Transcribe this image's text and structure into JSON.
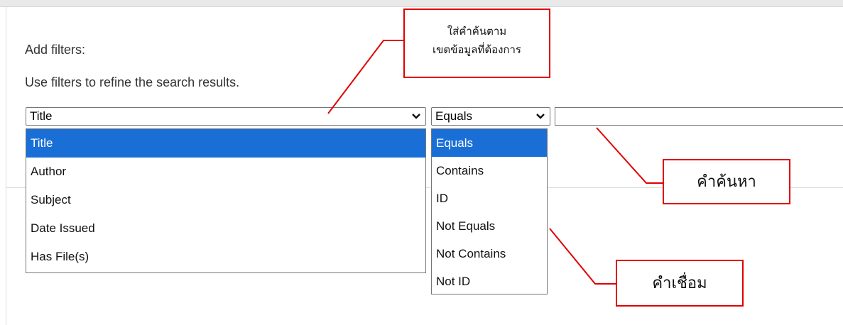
{
  "filters": {
    "heading": "Add filters:",
    "help": "Use filters to refine the search results.",
    "field_select": {
      "value": "Title",
      "options": [
        {
          "label": "Title",
          "selected": true
        },
        {
          "label": "Author",
          "selected": false
        },
        {
          "label": "Subject",
          "selected": false
        },
        {
          "label": "Date Issued",
          "selected": false
        },
        {
          "label": "Has File(s)",
          "selected": false
        }
      ]
    },
    "operator_select": {
      "value": "Equals",
      "options": [
        {
          "label": "Equals",
          "selected": true
        },
        {
          "label": "Contains",
          "selected": false
        },
        {
          "label": "ID",
          "selected": false
        },
        {
          "label": "Not Equals",
          "selected": false
        },
        {
          "label": "Not Contains",
          "selected": false
        },
        {
          "label": "Not ID",
          "selected": false
        }
      ]
    },
    "query_input": {
      "value": ""
    }
  },
  "annotations": {
    "field_note_line1": "ใส่คำค้นตาม",
    "field_note_line2": "เขตข้อมูลที่ต้องการ",
    "query_note": "คำค้นหา",
    "operator_note": "คำเชื่อม"
  },
  "colors": {
    "selection": "#1a6fd6",
    "callout_border": "#e00000",
    "callout_line": "#e00000"
  }
}
